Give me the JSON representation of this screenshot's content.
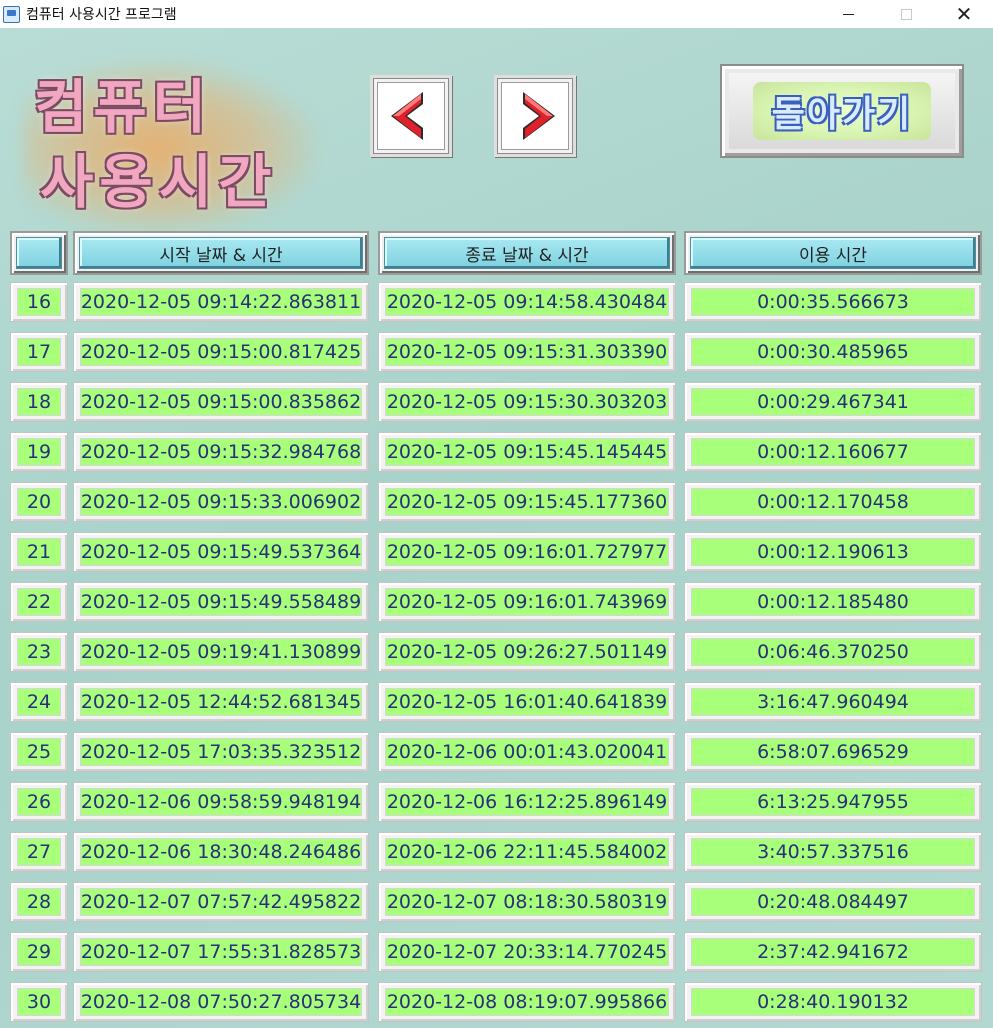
{
  "window": {
    "title": "컴퓨터 사용시간 프로그램",
    "minimize": "",
    "maximize": "",
    "close": "✕"
  },
  "logo": {
    "line1": "컴퓨터",
    "line2": "사용시간"
  },
  "nav": {
    "prev_icon": "left-arrow-icon",
    "next_icon": "right-arrow-icon"
  },
  "back_button": {
    "label": "돌아가기"
  },
  "table": {
    "headers": [
      "",
      "시작 날짜 & 시간",
      "종료 날짜 & 시간",
      "이용 시간"
    ],
    "rows": [
      [
        "16",
        "2020-12-05 09:14:22.863811",
        "2020-12-05 09:14:58.430484",
        "0:00:35.566673"
      ],
      [
        "17",
        "2020-12-05 09:15:00.817425",
        "2020-12-05 09:15:31.303390",
        "0:00:30.485965"
      ],
      [
        "18",
        "2020-12-05 09:15:00.835862",
        "2020-12-05 09:15:30.303203",
        "0:00:29.467341"
      ],
      [
        "19",
        "2020-12-05 09:15:32.984768",
        "2020-12-05 09:15:45.145445",
        "0:00:12.160677"
      ],
      [
        "20",
        "2020-12-05 09:15:33.006902",
        "2020-12-05 09:15:45.177360",
        "0:00:12.170458"
      ],
      [
        "21",
        "2020-12-05 09:15:49.537364",
        "2020-12-05 09:16:01.727977",
        "0:00:12.190613"
      ],
      [
        "22",
        "2020-12-05 09:15:49.558489",
        "2020-12-05 09:16:01.743969",
        "0:00:12.185480"
      ],
      [
        "23",
        "2020-12-05 09:19:41.130899",
        "2020-12-05 09:26:27.501149",
        "0:06:46.370250"
      ],
      [
        "24",
        "2020-12-05 12:44:52.681345",
        "2020-12-05 16:01:40.641839",
        "3:16:47.960494"
      ],
      [
        "25",
        "2020-12-05 17:03:35.323512",
        "2020-12-06 00:01:43.020041",
        "6:58:07.696529"
      ],
      [
        "26",
        "2020-12-06 09:58:59.948194",
        "2020-12-06 16:12:25.896149",
        "6:13:25.947955"
      ],
      [
        "27",
        "2020-12-06 18:30:48.246486",
        "2020-12-06 22:11:45.584002",
        "3:40:57.337516"
      ],
      [
        "28",
        "2020-12-07 07:57:42.495822",
        "2020-12-07 08:18:30.580319",
        "0:20:48.084497"
      ],
      [
        "29",
        "2020-12-07 17:55:31.828573",
        "2020-12-07 20:33:14.770245",
        "2:37:42.941672"
      ],
      [
        "30",
        "2020-12-08 07:50:27.805734",
        "2020-12-08 08:19:07.995866",
        "0:28:40.190132"
      ]
    ]
  },
  "colors": {
    "background": "#b3d8d2",
    "header_face": "#8fdbe8",
    "cell_value": "#a8ff7a",
    "cell_text": "#2a2f7a",
    "logo_fill": "#f1a7c0"
  }
}
